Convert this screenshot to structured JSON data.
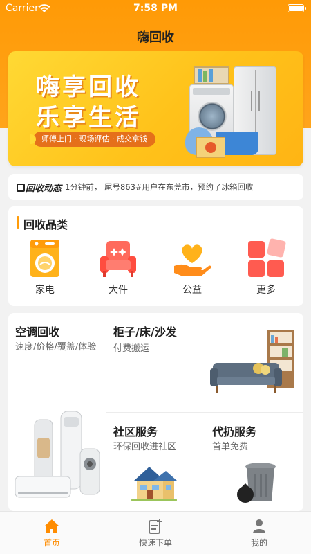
{
  "status_bar": {
    "carrier": "Carrier",
    "time": "7:58 PM"
  },
  "nav": {
    "title": "嗨回收"
  },
  "banner": {
    "line1": "嗨享回收",
    "line2": "乐享生活",
    "tagline": "师傅上门 · 现场评估 · 成交拿钱"
  },
  "news": {
    "logo": "回收动态",
    "text": "1分钟前，  尾号863#用户在东莞市，预约了冰箱回收"
  },
  "categories": {
    "title": "回收品类",
    "items": [
      {
        "label": "家电",
        "icon": "washing-machine-icon"
      },
      {
        "label": "大件",
        "icon": "armchair-icon"
      },
      {
        "label": "公益",
        "icon": "heart-hand-icon"
      },
      {
        "label": "更多",
        "icon": "grid-more-icon"
      }
    ]
  },
  "services": {
    "ac": {
      "title": "空调回收",
      "subtitle": "速度/价格/覆盖/体验"
    },
    "furniture": {
      "title": "柜子/床/沙发",
      "subtitle": "付费搬运"
    },
    "community": {
      "title": "社区服务",
      "subtitle": "环保回收进社区"
    },
    "disposal": {
      "title": "代扔服务",
      "subtitle": "首单免费"
    }
  },
  "tabbar": {
    "items": [
      {
        "label": "首页",
        "icon": "home-icon",
        "active": true
      },
      {
        "label": "快速下单",
        "icon": "quick-order-icon",
        "active": false
      },
      {
        "label": "我的",
        "icon": "user-icon",
        "active": false
      }
    ]
  },
  "colors": {
    "accent": "#ff9c0a",
    "active_tab": "#ff8c00"
  }
}
